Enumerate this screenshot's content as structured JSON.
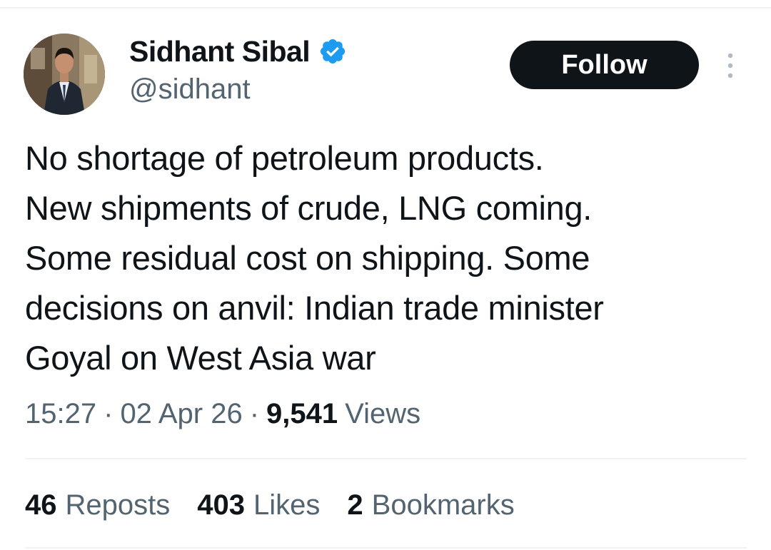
{
  "author": {
    "display_name": "Sidhant Sibal",
    "handle": "@sidhant",
    "verified": true,
    "verified_color": "#1d9bf0"
  },
  "follow_button": {
    "label": "Follow",
    "background": "#0f1419",
    "text_color": "#ffffff"
  },
  "tweet": {
    "text": "No shortage of petroleum products.\nNew shipments of crude, LNG coming.\nSome residual cost on shipping. Some\ndecisions on anvil: Indian trade minister\nGoyal on West Asia war"
  },
  "meta": {
    "time": "15:27",
    "separator": "·",
    "date": "02 Apr 26",
    "views_count": "9,541",
    "views_label": "Views"
  },
  "stats": [
    {
      "count": "46",
      "label": "Reposts"
    },
    {
      "count": "403",
      "label": "Likes"
    },
    {
      "count": "2",
      "label": "Bookmarks"
    }
  ],
  "icons": {
    "verified": "verified-badge-icon",
    "more": "more-options-icon"
  }
}
